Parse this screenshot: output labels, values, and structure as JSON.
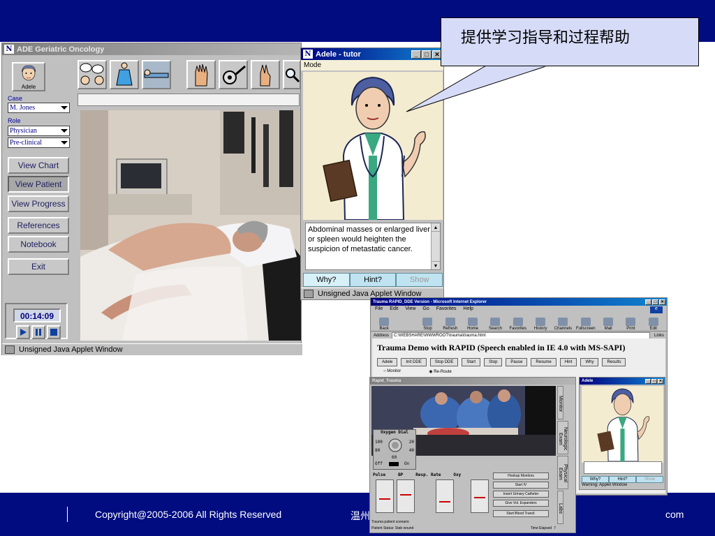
{
  "callout": {
    "text": "提供学习指导和过程帮助"
  },
  "footer": {
    "copyright": "Copyright@2005-2006 All Rights Reserved",
    "mid": "温州",
    "right": "com"
  },
  "ade": {
    "title": "ADE Geriatric Oncology",
    "avatar_label": "Adele",
    "case_label": "Case",
    "case_value": "M. Jones",
    "role_label": "Role",
    "role_value": "Physician",
    "stage_value": "Pre-clinical",
    "buttons": [
      "View Chart",
      "View Patient",
      "View Progress",
      "References",
      "Notebook",
      "Exit"
    ],
    "timer": "00:14:09",
    "status": "Unsigned Java Applet Window"
  },
  "tutor": {
    "title": "Adele - tutor",
    "menu": "Mode",
    "message": "Abdominal masses or enlarged liver or spleen would heighten the suspicion of metastatic cancer.",
    "buttons": [
      "Why?",
      "Hint?",
      "Show"
    ],
    "status": "Unsigned Java Applet Window"
  },
  "ie": {
    "title": "Trauma RAPID_DDE Version - Microsoft Internet Explorer",
    "menu": [
      "File",
      "Edit",
      "View",
      "Go",
      "Favorites",
      "Help"
    ],
    "tools": [
      "Back",
      "Stop",
      "Refresh",
      "Home",
      "Search",
      "Favorites",
      "History",
      "Channels",
      "Fullscreen",
      "Mail",
      "Print",
      "Edit"
    ],
    "address_label": "Address",
    "address": "C:\\WEBSHARE\\WWWROOT\\trauma\\trauma.html",
    "links": "Links",
    "heading": "Trauma Demo with RAPID (Speech enabled in IE 4.0 with MS-SAPI)",
    "demo_buttons": [
      "Adele",
      "Init DDE",
      "Stop DDE",
      "Start",
      "Stop",
      "Pause",
      "Resume",
      "Hint",
      "Why",
      "Results"
    ],
    "radios": [
      "Monitor",
      "Re-Route"
    ]
  },
  "trauma": {
    "title": "Rapid_Trauma",
    "tabs": [
      "Monitor",
      "Neurologic Exam",
      "Physical Exam",
      "Labs"
    ],
    "dial_title": "Oxygen Dial",
    "dial_values": [
      "100",
      "20",
      "80",
      "40",
      "60"
    ],
    "dial_off": "Off",
    "dial_on": "On",
    "gauges": [
      "Pulse",
      "BP",
      "Resp. Rate",
      "Oxy"
    ],
    "actions": [
      "Hookup Monitors",
      "Start IV",
      "Insert Urinary Catheter",
      "Give Vol. Expanders",
      "Start Blood Transf."
    ],
    "status_lines": [
      "Trauma patient scenario",
      "Patient Status: Stab wound"
    ],
    "time_label": "Time Elapsed",
    "time_value": "7"
  },
  "adele2": {
    "title": "Adele",
    "buttons": [
      "Why?",
      "Hint?",
      "Show"
    ],
    "status": "Warning: Applet Window"
  },
  "colors": {
    "band": "#000c80",
    "callout": "#d6dcf8",
    "title_active": "#000080"
  }
}
